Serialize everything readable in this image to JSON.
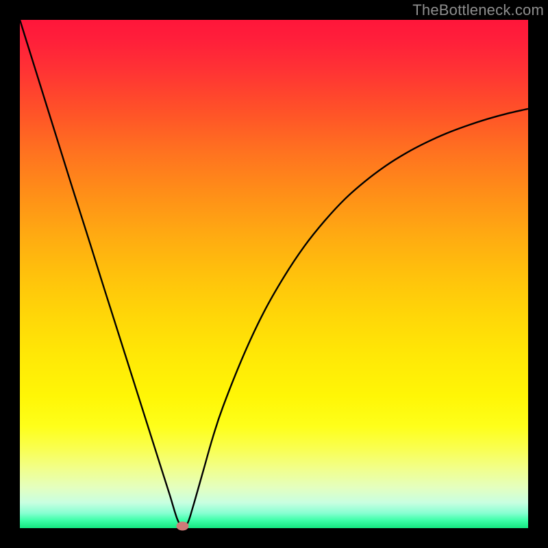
{
  "watermark": "TheBottleneck.com",
  "colors": {
    "background": "#000000",
    "curve": "#000000",
    "dot": "#cf7a78",
    "watermark": "#8e8e8e"
  },
  "chart_data": {
    "type": "line",
    "title": "",
    "xlabel": "",
    "ylabel": "",
    "xlim": [
      0,
      100
    ],
    "ylim": [
      0,
      100
    ],
    "x": [
      0,
      2,
      4,
      6,
      8,
      10,
      12,
      14,
      16,
      18,
      20,
      22,
      24,
      26,
      28,
      29.5,
      31,
      32,
      33,
      34,
      36,
      38,
      40,
      44,
      48,
      52,
      56,
      60,
      64,
      68,
      72,
      76,
      80,
      84,
      88,
      92,
      96,
      100
    ],
    "y": [
      100,
      93.6,
      87.2,
      80.8,
      74.4,
      68.0,
      61.7,
      55.4,
      49.0,
      42.7,
      36.4,
      30.1,
      23.8,
      17.5,
      11.2,
      6.5,
      1.7,
      0.4,
      1.0,
      4.0,
      11.0,
      18.0,
      24.0,
      34.0,
      42.5,
      49.5,
      55.5,
      60.5,
      64.8,
      68.3,
      71.3,
      73.8,
      75.9,
      77.7,
      79.2,
      80.5,
      81.6,
      82.5
    ],
    "minimum_marker": {
      "x": 32,
      "y": 0.4
    },
    "gradient_stops": [
      {
        "pos": 0,
        "color": "#ff163a"
      },
      {
        "pos": 0.5,
        "color": "#ffc10c"
      },
      {
        "pos": 0.8,
        "color": "#feff1a"
      },
      {
        "pos": 1.0,
        "color": "#14e780"
      }
    ]
  }
}
